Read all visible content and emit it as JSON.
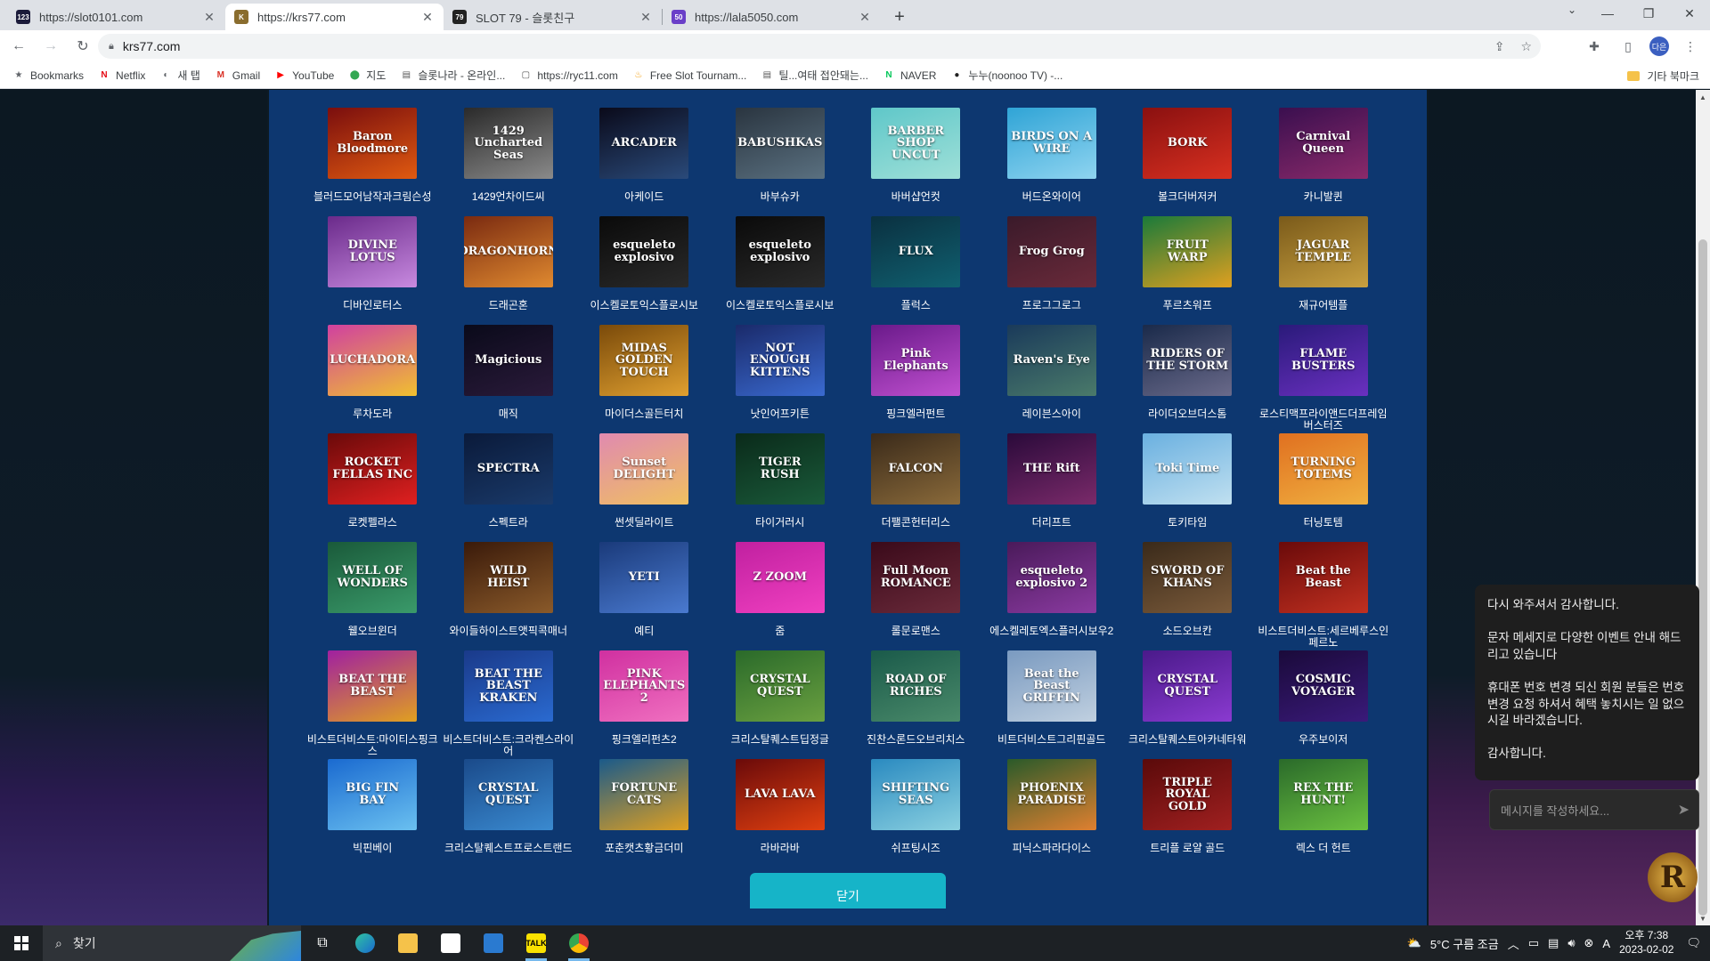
{
  "browser": {
    "tabs": [
      {
        "title": "https://slot0101.com",
        "favicon": "123",
        "color": "#1b1b3a",
        "active": false
      },
      {
        "title": "https://krs77.com",
        "favicon": "K",
        "color": "#8a6d2e",
        "active": true
      },
      {
        "title": "SLOT 79 - 슬롯친구",
        "favicon": "79",
        "color": "#222222",
        "active": false
      },
      {
        "title": "https://lala5050.com",
        "favicon": "50",
        "color": "#6a3fc8",
        "active": false
      }
    ],
    "new_tab_icon": "plus-icon",
    "url": "krs77.com",
    "bookmarks": [
      {
        "label": "Bookmarks",
        "icon": "★",
        "color": "#5f6368"
      },
      {
        "label": "Netflix",
        "icon": "N",
        "color": "#e50914"
      },
      {
        "label": "새 탭",
        "icon": "◐",
        "color": "#5f6368"
      },
      {
        "label": "Gmail",
        "icon": "M",
        "color": "#d93025"
      },
      {
        "label": "YouTube",
        "icon": "▶",
        "color": "#ff0000"
      },
      {
        "label": "지도",
        "icon": "⬤",
        "color": "#34a853"
      },
      {
        "label": "슬롯나라 - 온라인...",
        "icon": "▤",
        "color": "#555555"
      },
      {
        "label": "https://ryc11.com",
        "icon": "▢",
        "color": "#555555"
      },
      {
        "label": "Free Slot Tournam...",
        "icon": "♨",
        "color": "#f29900"
      },
      {
        "label": "틸...여태 접안돼는...",
        "icon": "▤",
        "color": "#555555"
      },
      {
        "label": "NAVER",
        "icon": "N",
        "color": "#03c75a"
      },
      {
        "label": "누누(noonoo TV) -...",
        "icon": "●",
        "color": "#222222"
      }
    ],
    "other_bookmarks": "기타 북마크"
  },
  "games": [
    {
      "name": "블러드모어남작과크림슨성",
      "thumb": "Baron Bloodmore",
      "c1": "#7a0e0e",
      "c2": "#e05a10"
    },
    {
      "name": "1429언차이드씨",
      "thumb": "1429 Uncharted Seas",
      "c1": "#2a2a2a",
      "c2": "#8a8a8a"
    },
    {
      "name": "아케이드",
      "thumb": "ARCADER",
      "c1": "#0a0a1a",
      "c2": "#2a4a7a"
    },
    {
      "name": "바부슈카",
      "thumb": "BABUSHKAS",
      "c1": "#2a3540",
      "c2": "#5a7080"
    },
    {
      "name": "바버샵언컷",
      "thumb": "BARBER SHOP UNCUT",
      "c1": "#5fc7c9",
      "c2": "#9fe0d8"
    },
    {
      "name": "버드온와이어",
      "thumb": "BIRDS ON A WIRE",
      "c1": "#2fa4d6",
      "c2": "#8fd4f0"
    },
    {
      "name": "볼크더버저커",
      "thumb": "BORK",
      "c1": "#8a1010",
      "c2": "#d83020"
    },
    {
      "name": "카니발퀸",
      "thumb": "Carnival Queen",
      "c1": "#3a0f4f",
      "c2": "#8a2a6a"
    },
    {
      "name": "디바인로터스",
      "thumb": "DIVINE LOTUS",
      "c1": "#6a2a8a",
      "c2": "#c88ae0"
    },
    {
      "name": "드래곤혼",
      "thumb": "DRAGONHORN",
      "c1": "#7a2a10",
      "c2": "#e08a30"
    },
    {
      "name": "이스켈로토익스플로시보",
      "thumb": "esqueleto explosivo",
      "c1": "#0a0a0a",
      "c2": "#2a2a2a"
    },
    {
      "name": "이스켈로토익스플로시보",
      "thumb": "esqueleto explosivo",
      "c1": "#0a0a0a",
      "c2": "#2a2a2a"
    },
    {
      "name": "플럭스",
      "thumb": "FLUX",
      "c1": "#0a3040",
      "c2": "#106070"
    },
    {
      "name": "프로그그로그",
      "thumb": "Frog Grog",
      "c1": "#3a1a2a",
      "c2": "#6a2a3a"
    },
    {
      "name": "푸르츠워프",
      "thumb": "FRUIT WARP",
      "c1": "#1a7a3a",
      "c2": "#e0a020"
    },
    {
      "name": "재규어템플",
      "thumb": "JAGUAR TEMPLE",
      "c1": "#7a5a1a",
      "c2": "#c8a040"
    },
    {
      "name": "루차도라",
      "thumb": "LUCHADORA",
      "c1": "#d040a0",
      "c2": "#f0c030"
    },
    {
      "name": "매직",
      "thumb": "Magicious",
      "c1": "#0a0a1a",
      "c2": "#2a1a3a"
    },
    {
      "name": "마이더스골든터치",
      "thumb": "MIDAS GOLDEN TOUCH",
      "c1": "#7a4a0a",
      "c2": "#e0a030"
    },
    {
      "name": "낫인어프키튼",
      "thumb": "NOT ENOUGH KITTENS",
      "c1": "#1a2a6a",
      "c2": "#3a6ad0"
    },
    {
      "name": "핑크엘러펀트",
      "thumb": "Pink Elephants",
      "c1": "#6a1a8a",
      "c2": "#c050d0"
    },
    {
      "name": "레이븐스아이",
      "thumb": "Raven's Eye",
      "c1": "#1a3a5a",
      "c2": "#4a7a6a"
    },
    {
      "name": "라이더오브더스톰",
      "thumb": "RIDERS OF THE STORM",
      "c1": "#1a2a4a",
      "c2": "#6a6a8a"
    },
    {
      "name": "로스티맥프라이앤드더프레임버스터즈",
      "thumb": "FLAME BUSTERS",
      "c1": "#2a1a7a",
      "c2": "#6a30c0"
    },
    {
      "name": "로켓펠라스",
      "thumb": "ROCKET FELLAS INC",
      "c1": "#6a0a0a",
      "c2": "#e02020"
    },
    {
      "name": "스펙트라",
      "thumb": "SPECTRA",
      "c1": "#0a1a3a",
      "c2": "#1a3a6a"
    },
    {
      "name": "썬셋딜라이트",
      "thumb": "Sunset DELIGHT",
      "c1": "#e08ab0",
      "c2": "#f0c060"
    },
    {
      "name": "타이거러시",
      "thumb": "TIGER RUSH",
      "c1": "#0a2a1a",
      "c2": "#1a5a3a"
    },
    {
      "name": "더팰콘헌터리스",
      "thumb": "FALCON",
      "c1": "#3a2a1a",
      "c2": "#8a6a3a"
    },
    {
      "name": "더리프트",
      "thumb": "THE Rift",
      "c1": "#2a0a3a",
      "c2": "#7a2a6a"
    },
    {
      "name": "토키타임",
      "thumb": "Toki Time",
      "c1": "#6ab0e0",
      "c2": "#c0e0f0"
    },
    {
      "name": "터닝토템",
      "thumb": "TURNING TOTEMS",
      "c1": "#e07020",
      "c2": "#f0b040"
    },
    {
      "name": "웰오브윈더",
      "thumb": "WELL OF WONDERS",
      "c1": "#1a5a3a",
      "c2": "#3a9a6a"
    },
    {
      "name": "와이들하이스트앳픽콕매너",
      "thumb": "WILD HEIST",
      "c1": "#3a1a0a",
      "c2": "#8a5a2a"
    },
    {
      "name": "예티",
      "thumb": "YETI",
      "c1": "#1a3a7a",
      "c2": "#4a7ad0"
    },
    {
      "name": "줌",
      "thumb": "Z ZOOM",
      "c1": "#c020a0",
      "c2": "#f040c0"
    },
    {
      "name": "롤문로맨스",
      "thumb": "Full Moon ROMANCE",
      "c1": "#3a0a1a",
      "c2": "#6a2a3a"
    },
    {
      "name": "에스켈레토엑스플러시보우2",
      "thumb": "esqueleto explosivo 2",
      "c1": "#4a1a5a",
      "c2": "#8a3aa0"
    },
    {
      "name": "소드오브칸",
      "thumb": "SWORD OF KHANS",
      "c1": "#3a2a1a",
      "c2": "#7a5a3a"
    },
    {
      "name": "비스트더비스트:세르베루스인페르노",
      "thumb": "Beat the Beast",
      "c1": "#6a0a0a",
      "c2": "#c03020"
    },
    {
      "name": "비스트더비스트:마이티스핑크스",
      "thumb": "BEAT THE BEAST",
      "c1": "#a020a0",
      "c2": "#e0a020"
    },
    {
      "name": "비스트더비스트:크라켄스라이어",
      "thumb": "BEAT THE BEAST KRAKEN",
      "c1": "#1a3a8a",
      "c2": "#2a6ad0"
    },
    {
      "name": "핑크엘리펀츠2",
      "thumb": "PINK ELEPHANTS 2",
      "c1": "#d030a0",
      "c2": "#f070c0"
    },
    {
      "name": "크리스탈퀘스트딥정글",
      "thumb": "CRYSTAL QUEST",
      "c1": "#2a6a2a",
      "c2": "#6aa040"
    },
    {
      "name": "진찬스론드오브리치스",
      "thumb": "ROAD OF RICHES",
      "c1": "#1a5a4a",
      "c2": "#4a8a6a"
    },
    {
      "name": "비트더비스트그리핀골드",
      "thumb": "Beat the Beast GRIFFIN",
      "c1": "#7a9ac0",
      "c2": "#c0d0e0"
    },
    {
      "name": "크리스탈퀘스트아카네타워",
      "thumb": "CRYSTAL QUEST",
      "c1": "#4a1a8a",
      "c2": "#8a3ad0"
    },
    {
      "name": "우주보이저",
      "thumb": "COSMIC VOYAGER",
      "c1": "#1a0a3a",
      "c2": "#3a1a7a"
    },
    {
      "name": "빅핀베이",
      "thumb": "BIG FIN BAY",
      "c1": "#1a6ad0",
      "c2": "#6ac0f0"
    },
    {
      "name": "크리스탈퀘스트프로스트랜드",
      "thumb": "CRYSTAL QUEST",
      "c1": "#1a4a8a",
      "c2": "#3a8ad0"
    },
    {
      "name": "포춘캣츠황금더미",
      "thumb": "FORTUNE CATS",
      "c1": "#1a5a8a",
      "c2": "#e0a020"
    },
    {
      "name": "라바라바",
      "thumb": "LAVA LAVA",
      "c1": "#6a0a0a",
      "c2": "#e04010"
    },
    {
      "name": "쉬프팅시즈",
      "thumb": "SHIFTING SEAS",
      "c1": "#2a8ac0",
      "c2": "#8ad0e0"
    },
    {
      "name": "피닉스파라다이스",
      "thumb": "PHOENIX PARADISE",
      "c1": "#2a5a2a",
      "c2": "#e08030"
    },
    {
      "name": "트리플 로얄 골드",
      "thumb": "TRIPLE ROYAL GOLD",
      "c1": "#5a0a0a",
      "c2": "#a02020"
    },
    {
      "name": "렉스 더 헌트",
      "thumb": "REX THE HUNT!",
      "c1": "#2a6a2a",
      "c2": "#6ac040"
    }
  ],
  "close_button": "닫기",
  "chat": {
    "messages": [
      "다시 와주셔서 감사합니다.",
      "문자 메세지로 다양한 이벤트 안내 해드리고 있습니다",
      "휴대폰 번호 변경 되신 회원 분들은 번호 변경 요청 하셔서 혜택 놓치시는 일 없으시길 바라겠습니다.",
      "감사합니다."
    ],
    "input_placeholder": "메시지를 작성하세요...",
    "logo": "R"
  },
  "taskbar": {
    "search_label": "찾기",
    "weather": "5°C  구름 조금",
    "time": "오후 7:38",
    "date": "2023-02-02",
    "ime": "A"
  }
}
